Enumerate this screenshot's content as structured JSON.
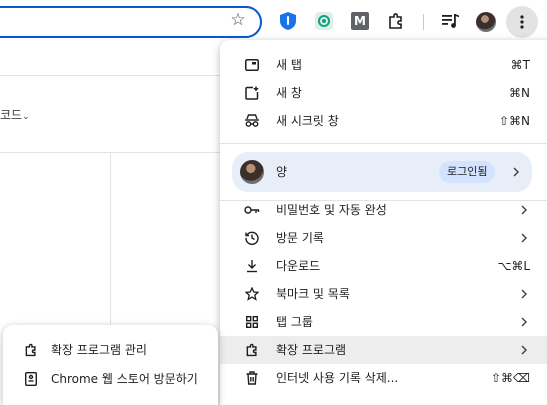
{
  "page": {
    "snippet": "코드"
  },
  "toolbar": {
    "extensions": [
      {
        "name": "shield-extension-icon",
        "color": "#1a73e8"
      },
      {
        "name": "chatgpt-extension-icon",
        "color": "#10a37f"
      },
      {
        "name": "m-extension-icon",
        "label": "M",
        "color": "#5f6368"
      }
    ]
  },
  "menu": {
    "items": [
      {
        "label": "새 탭",
        "shortcut": "⌘T"
      },
      {
        "label": "새 창",
        "shortcut": "⌘N"
      },
      {
        "label": "새 시크릿 창",
        "shortcut": "⇧⌘N"
      }
    ],
    "profile": {
      "name": "양",
      "signin_label": "로그인됨"
    },
    "items2": [
      {
        "label": "비밀번호 및 자동 완성"
      },
      {
        "label": "방문 기록"
      },
      {
        "label": "다운로드",
        "shortcut": "⌥⌘L"
      },
      {
        "label": "북마크 및 목록"
      },
      {
        "label": "탭 그룹"
      },
      {
        "label": "확장 프로그램"
      },
      {
        "label": "인터넷 사용 기록 삭제...",
        "shortcut": "⇧⌘⌫"
      }
    ]
  },
  "submenu": {
    "items": [
      {
        "label": "확장 프로그램 관리"
      },
      {
        "label": "Chrome 웹 스토어 방문하기"
      }
    ]
  },
  "colors": {
    "accent": "#0b57d0",
    "profile_bg": "#e8eef8",
    "chip_bg": "#d3e3fd",
    "hover_bg": "#ededed"
  }
}
